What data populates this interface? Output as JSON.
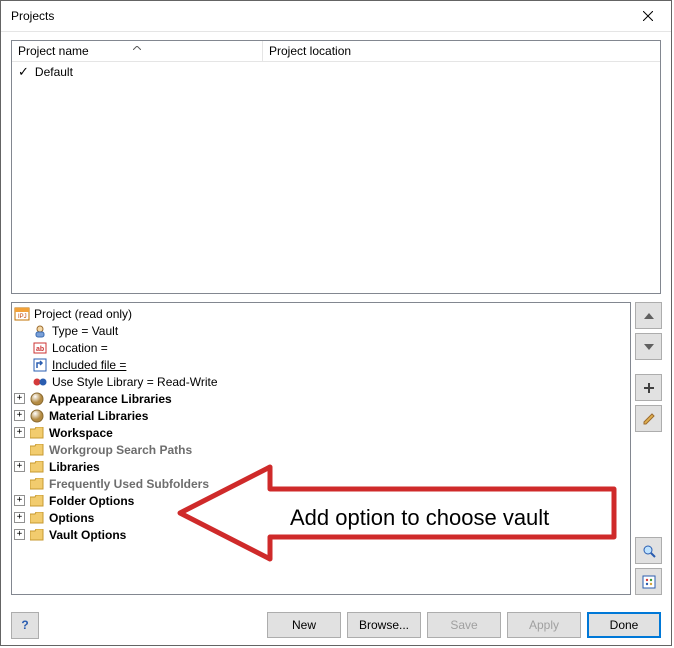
{
  "window": {
    "title": "Projects"
  },
  "columns": {
    "name": "Project name",
    "location": "Project location"
  },
  "projects": [
    {
      "name": "Default",
      "checked": true
    }
  ],
  "tree": {
    "root_label": "Project (read only)",
    "type_row": "Type = Vault",
    "location_row": "Location =",
    "included_row": "Included file =",
    "style_row": "Use Style Library = Read-Write",
    "appearance": "Appearance Libraries",
    "material": "Material Libraries",
    "workspace": "Workspace",
    "workgroup": "Workgroup Search Paths",
    "libraries": "Libraries",
    "freq": "Frequently Used Subfolders",
    "folder_opts": "Folder Options",
    "options": "Options",
    "vault_opts": "Vault Options"
  },
  "buttons": {
    "new": "New",
    "browse": "Browse...",
    "save": "Save",
    "apply": "Apply",
    "done": "Done"
  },
  "annotation": {
    "text": "Add option to choose vault"
  }
}
